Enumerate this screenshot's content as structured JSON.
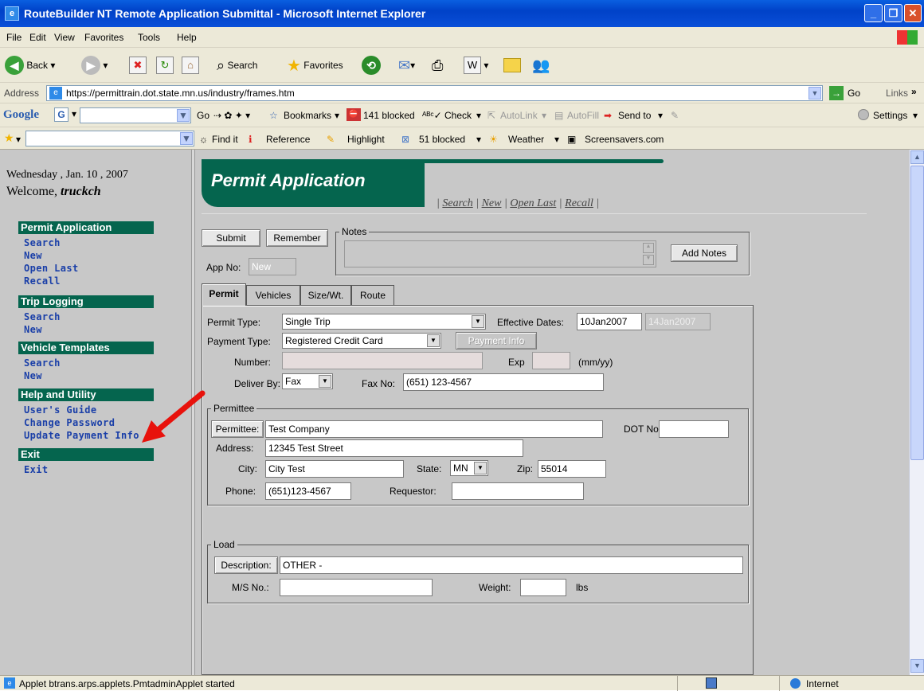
{
  "window": {
    "title": "RouteBuilder NT Remote Application Submittal - Microsoft Internet Explorer"
  },
  "menu": [
    "File",
    "Edit",
    "View",
    "Favorites",
    "Tools",
    "Help"
  ],
  "toolbar": {
    "back": "Back",
    "search": "Search",
    "favorites": "Favorites"
  },
  "address": {
    "label": "Address",
    "url": "https://permittrain.dot.state.mn.us/industry/frames.htm",
    "go": "Go",
    "links": "Links"
  },
  "google": {
    "brand": "Google",
    "go": "Go",
    "bookmarks": "Bookmarks",
    "blocked": "141 blocked",
    "check": "Check",
    "autolink": "AutoLink",
    "autofill": "AutoFill",
    "sendto": "Send to",
    "settings": "Settings"
  },
  "links_bar": {
    "findit": "Find it",
    "reference": "Reference",
    "highlight": "Highlight",
    "blocked": "51 blocked",
    "weather": "Weather",
    "screensavers": "Screensavers.com"
  },
  "sidebar": {
    "date": "Wednesday , Jan. 10 , 2007",
    "welcome_label": "Welcome,",
    "welcome_user": "truckch",
    "sections": [
      {
        "title": "Permit Application",
        "links": [
          "Search",
          "New",
          "Open Last",
          "Recall"
        ]
      },
      {
        "title": "Trip Logging",
        "links": [
          "Search",
          "New"
        ]
      },
      {
        "title": "Vehicle Templates",
        "links": [
          "Search",
          "New"
        ]
      },
      {
        "title": "Help and Utility",
        "links": [
          "User's Guide",
          "Change Password",
          "Update Payment Info"
        ]
      },
      {
        "title": "Exit",
        "links": [
          "Exit"
        ]
      }
    ]
  },
  "main": {
    "banner_title": "Permit Application",
    "links": [
      "Search",
      "New",
      "Open Last",
      "Recall"
    ],
    "submit": "Submit",
    "remember": "Remember",
    "notes_label": "Notes",
    "add_notes": "Add Notes",
    "app_no_label": "App No:",
    "app_no_value": "New",
    "tabs": [
      "Permit",
      "Vehicles",
      "Size/Wt.",
      "Route"
    ],
    "permit_type_label": "Permit Type:",
    "permit_type_value": "Single Trip",
    "effective_dates_label": "Effective Dates:",
    "effective_start": "10Jan2007",
    "effective_end": "14Jan2007",
    "payment_type_label": "Payment Type:",
    "payment_type_value": "Registered Credit Card",
    "payment_info": "Payment Info",
    "number_label": "Number:",
    "exp_label": "Exp",
    "mmyy": "(mm/yy)",
    "deliver_by_label": "Deliver By:",
    "deliver_by_value": "Fax",
    "fax_no_label": "Fax No:",
    "fax_no_value": "(651) 123-4567",
    "permittee_group": "Permittee",
    "permittee_btn": "Permittee:",
    "permittee_value": "Test Company",
    "dot_no_label": "DOT No:",
    "address_label": "Address:",
    "address_value": "12345 Test Street",
    "city_label": "City:",
    "city_value": "City Test",
    "state_label": "State:",
    "state_value": "MN",
    "zip_label": "Zip:",
    "zip_value": "55014",
    "phone_label": "Phone:",
    "phone_value": "(651)123-4567",
    "requestor_label": "Requestor:",
    "load_group": "Load",
    "description_btn": "Description:",
    "description_value": "OTHER -",
    "ms_no_label": "M/S No.:",
    "weight_label": "Weight:",
    "lbs": "lbs"
  },
  "status": {
    "text": "Applet btrans.arps.applets.PmtadminApplet started",
    "zone": "Internet"
  },
  "colors": {
    "accent": "#05654e",
    "link": "#1a3fa8",
    "arrow": "#e8120c"
  }
}
